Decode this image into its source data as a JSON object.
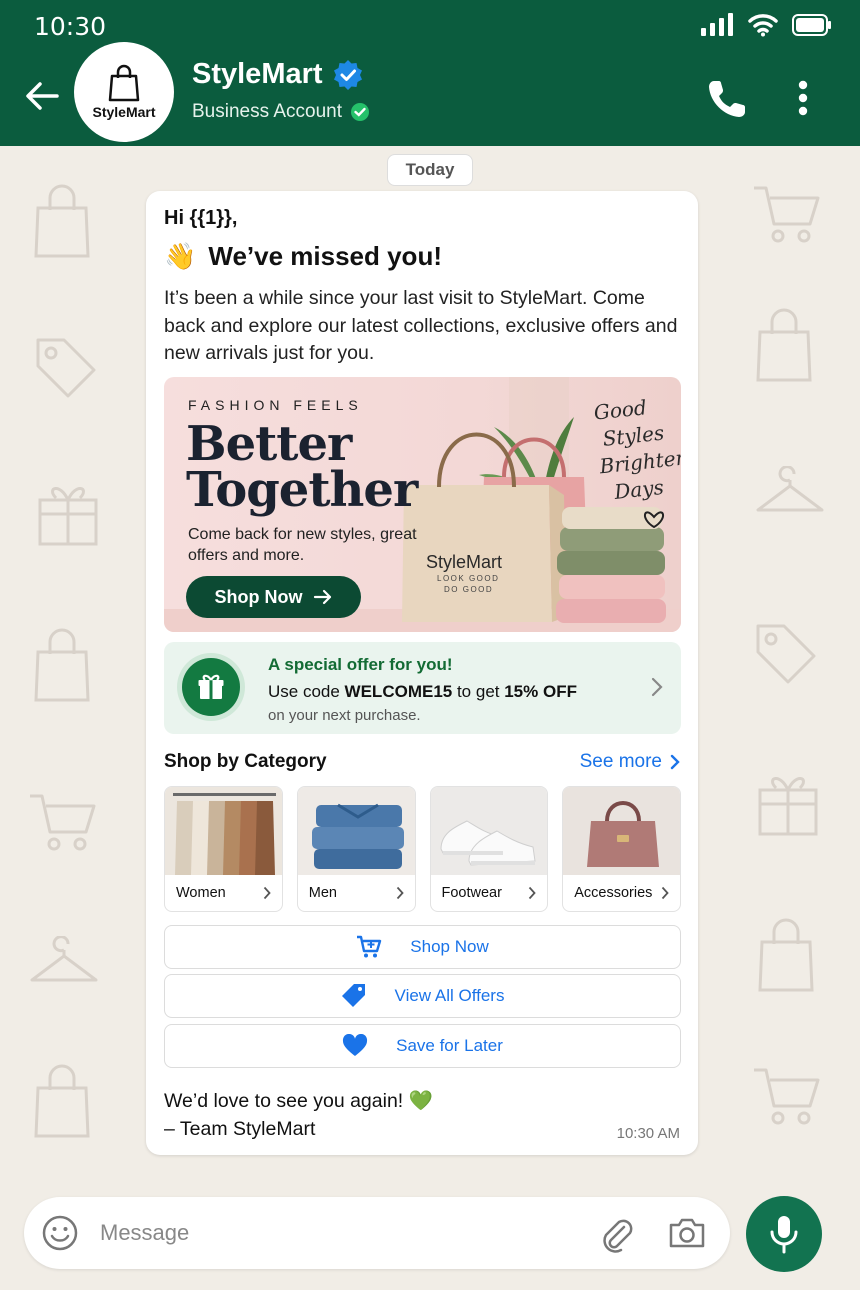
{
  "status_bar": {
    "time": "10:30"
  },
  "header": {
    "avatar_logo_text": "StyleMart",
    "business_name": "StyleMart",
    "subtitle": "Business Account",
    "accent_color": "#0b5c3e"
  },
  "chat": {
    "date_label": "Today",
    "message": {
      "greeting": "Hi {{1}},",
      "headline": "We’ve missed you!",
      "body": "It’s been a while since your last visit to StyleMart. Come back and explore our latest collections, exclusive offers and new arrivals just for you.",
      "banner": {
        "kicker": "FASHION FEELS",
        "title_line1": "Better",
        "title_line2": "Together",
        "subtitle": "Come back for new styles, great offers and more.",
        "button_label": "Shop Now",
        "bag_brand": "StyleMart",
        "bag_tag_line1": "LOOK GOOD",
        "bag_tag_line2": "DO GOOD",
        "script_lines": [
          "Good",
          "Styles",
          "Brighter",
          "Days"
        ]
      },
      "offer": {
        "title": "A special offer for you!",
        "line_prefix": "Use code ",
        "code": "WELCOME15",
        "line_mid": " to get ",
        "discount": "15% OFF",
        "note": "on your next purchase."
      },
      "categories": {
        "heading": "Shop by Category",
        "see_more_label": "See more",
        "items": [
          {
            "label": "Women"
          },
          {
            "label": "Men"
          },
          {
            "label": "Footwear"
          },
          {
            "label": "Accessories"
          }
        ]
      },
      "actions": [
        {
          "label": "Shop Now",
          "icon": "cart-icon"
        },
        {
          "label": "View All Offers",
          "icon": "tag-icon"
        },
        {
          "label": "Save for Later",
          "icon": "heart-icon"
        }
      ],
      "signoff_line1": "We’d love to see you again!",
      "signoff_line2": "– Team StyleMart",
      "time": "10:30 AM"
    }
  },
  "composer": {
    "placeholder": "Message"
  }
}
